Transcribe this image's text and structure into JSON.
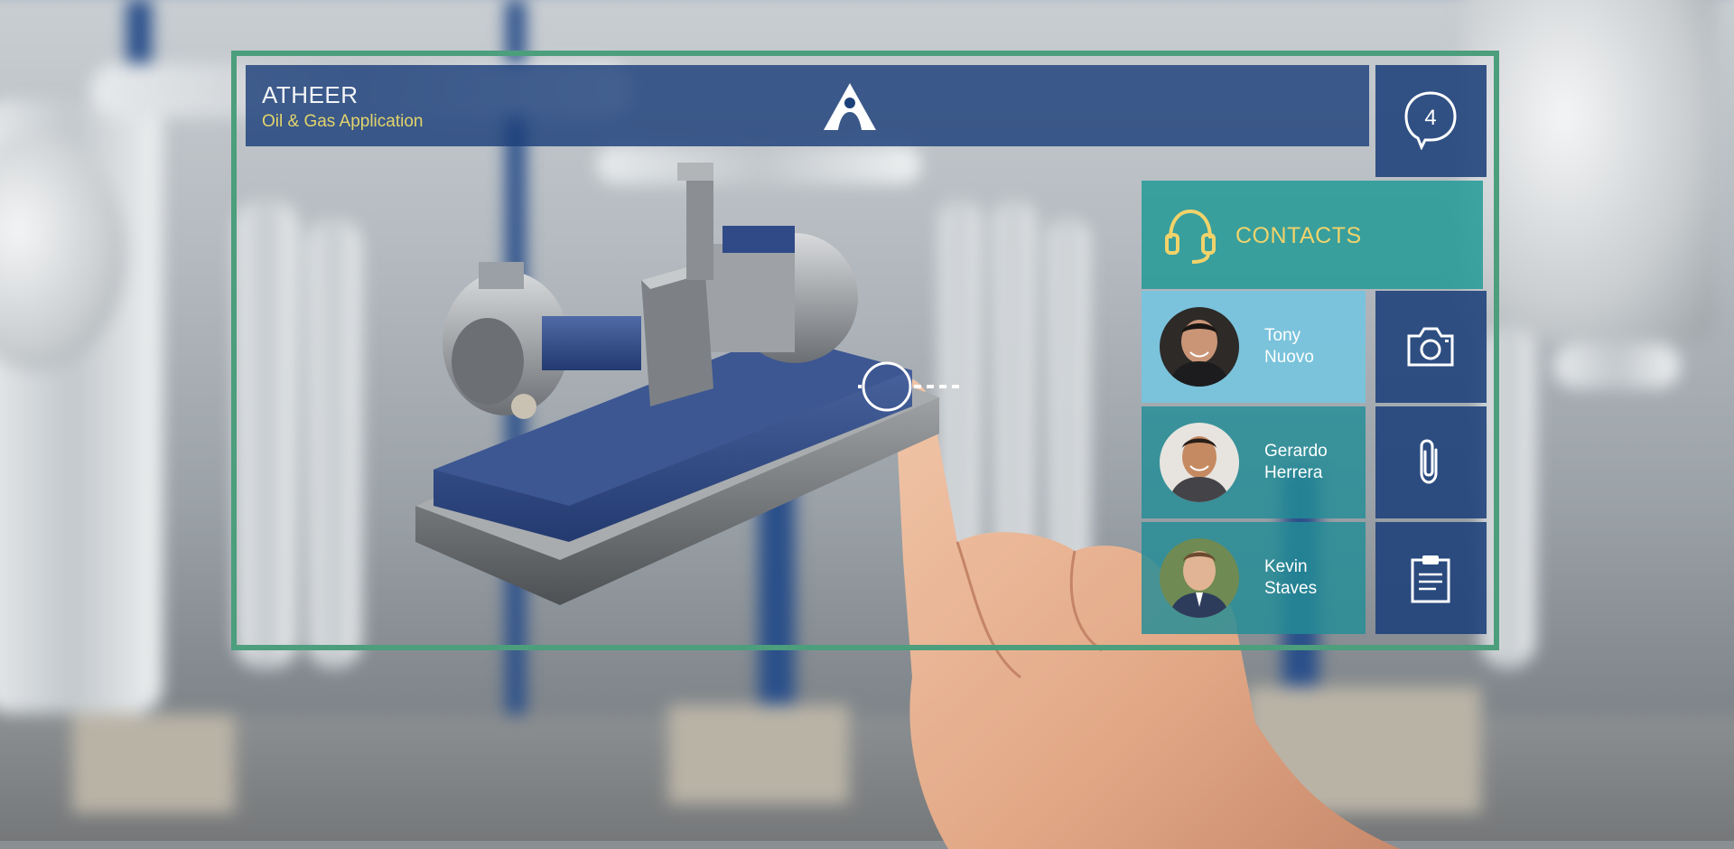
{
  "app": {
    "brand": "ATHEER",
    "subtitle": "Oil & Gas Application"
  },
  "notifications": {
    "count": "4",
    "icon": "chat-bubble-icon"
  },
  "contacts_panel": {
    "title": "CONTACTS",
    "icon": "headset-icon",
    "items": [
      {
        "first": "Tony",
        "last": "Nuovo",
        "selected": true
      },
      {
        "first": "Gerardo",
        "last": "Herrera",
        "selected": false
      },
      {
        "first": "Kevin",
        "last": "Staves",
        "selected": false
      }
    ]
  },
  "actions": [
    {
      "icon": "camera-icon"
    },
    {
      "icon": "paperclip-icon"
    },
    {
      "icon": "clipboard-icon"
    }
  ],
  "colors": {
    "frame": "#4c9e7c",
    "header": "#1c407a",
    "accent_yellow": "#e3d46b",
    "teal": "#229a96",
    "selected": "#76c4de"
  }
}
